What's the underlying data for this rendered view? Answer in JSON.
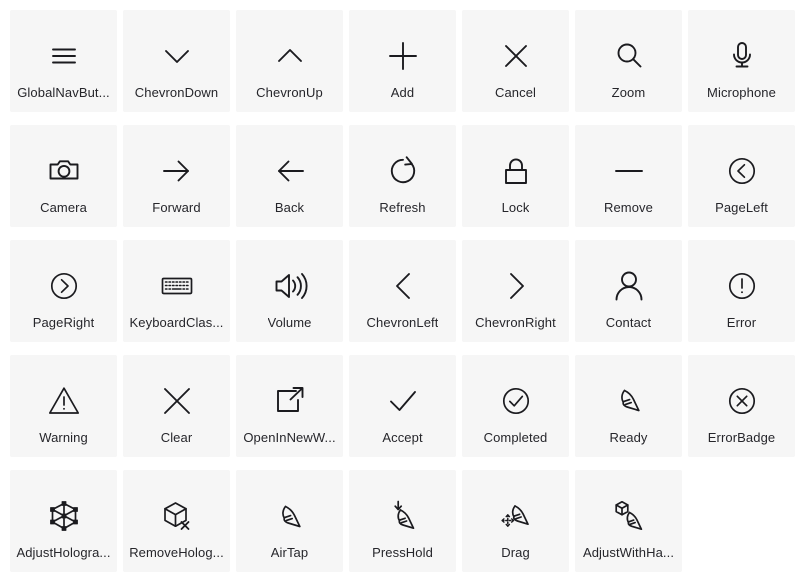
{
  "page": {
    "title": "Icon Gallery",
    "background_color": "#ffffff",
    "cell_background_color": "#f6f6f6",
    "icon_color": "#1b1b1f",
    "label_color": "#26262b",
    "columns": 7,
    "rows": 5,
    "total_icons": 34
  },
  "icons": [
    {
      "name": "GlobalNavButton",
      "label": "GlobalNavBut...",
      "glyph": "global-nav-button-icon"
    },
    {
      "name": "ChevronDown",
      "label": "ChevronDown",
      "glyph": "chevron-down-icon"
    },
    {
      "name": "ChevronUp",
      "label": "ChevronUp",
      "glyph": "chevron-up-icon"
    },
    {
      "name": "Add",
      "label": "Add",
      "glyph": "add-icon"
    },
    {
      "name": "Cancel",
      "label": "Cancel",
      "glyph": "cancel-icon"
    },
    {
      "name": "Zoom",
      "label": "Zoom",
      "glyph": "zoom-icon"
    },
    {
      "name": "Microphone",
      "label": "Microphone",
      "glyph": "microphone-icon"
    },
    {
      "name": "Camera",
      "label": "Camera",
      "glyph": "camera-icon"
    },
    {
      "name": "Forward",
      "label": "Forward",
      "glyph": "forward-icon"
    },
    {
      "name": "Back",
      "label": "Back",
      "glyph": "back-icon"
    },
    {
      "name": "Refresh",
      "label": "Refresh",
      "glyph": "refresh-icon"
    },
    {
      "name": "Lock",
      "label": "Lock",
      "glyph": "lock-icon"
    },
    {
      "name": "Remove",
      "label": "Remove",
      "glyph": "remove-icon"
    },
    {
      "name": "PageLeft",
      "label": "PageLeft",
      "glyph": "page-left-icon"
    },
    {
      "name": "PageRight",
      "label": "PageRight",
      "glyph": "page-right-icon"
    },
    {
      "name": "KeyboardClassic",
      "label": "KeyboardClas...",
      "glyph": "keyboard-classic-icon"
    },
    {
      "name": "Volume",
      "label": "Volume",
      "glyph": "volume-icon"
    },
    {
      "name": "ChevronLeft",
      "label": "ChevronLeft",
      "glyph": "chevron-left-icon"
    },
    {
      "name": "ChevronRight",
      "label": "ChevronRight",
      "glyph": "chevron-right-icon"
    },
    {
      "name": "Contact",
      "label": "Contact",
      "glyph": "contact-icon"
    },
    {
      "name": "Error",
      "label": "Error",
      "glyph": "error-icon"
    },
    {
      "name": "Warning",
      "label": "Warning",
      "glyph": "warning-icon"
    },
    {
      "name": "Clear",
      "label": "Clear",
      "glyph": "clear-icon"
    },
    {
      "name": "OpenInNewWindow",
      "label": "OpenInNewW...",
      "glyph": "open-in-new-window-icon"
    },
    {
      "name": "Accept",
      "label": "Accept",
      "glyph": "accept-icon"
    },
    {
      "name": "Completed",
      "label": "Completed",
      "glyph": "completed-icon"
    },
    {
      "name": "Ready",
      "label": "Ready",
      "glyph": "ready-icon"
    },
    {
      "name": "ErrorBadge",
      "label": "ErrorBadge",
      "glyph": "error-badge-icon"
    },
    {
      "name": "AdjustHologram",
      "label": "AdjustHologra...",
      "glyph": "adjust-hologram-icon"
    },
    {
      "name": "RemoveHologram",
      "label": "RemoveHolog...",
      "glyph": "remove-hologram-icon"
    },
    {
      "name": "AirTap",
      "label": "AirTap",
      "glyph": "air-tap-icon"
    },
    {
      "name": "PressHold",
      "label": "PressHold",
      "glyph": "press-hold-icon"
    },
    {
      "name": "Drag",
      "label": "Drag",
      "glyph": "drag-icon"
    },
    {
      "name": "AdjustWithHand",
      "label": "AdjustWithHa...",
      "glyph": "adjust-with-hand-icon"
    }
  ]
}
